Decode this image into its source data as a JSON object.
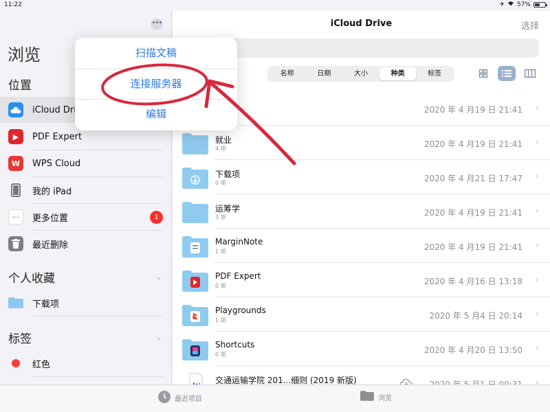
{
  "status_bar": {
    "time": "11:22",
    "battery": "57%",
    "battery_level": 0.57
  },
  "sidebar": {
    "more_label": "•••",
    "title": "浏览",
    "locations_header": "位置",
    "locations": [
      {
        "label": "iCloud Drive",
        "icon": "icloud-icon",
        "selected": true
      },
      {
        "label": "PDF Expert",
        "icon": "pdf-expert-icon"
      },
      {
        "label": "WPS Cloud",
        "icon": "wps-icon"
      },
      {
        "label": "我的 iPad",
        "icon": "ipad-icon"
      },
      {
        "label": "更多位置",
        "icon": "more-icon",
        "badge": "1"
      },
      {
        "label": "最近删除",
        "icon": "trash-icon"
      }
    ],
    "favorites_header": "个人收藏",
    "favorites": [
      {
        "label": "下载项",
        "icon": "folder-icon"
      }
    ],
    "tags_header": "标签",
    "tags": [
      {
        "label": "红色",
        "color": "#ff3b30"
      }
    ]
  },
  "popover": {
    "items": [
      "扫描文稿",
      "连接服务器",
      "编辑"
    ],
    "color": "#2f7ae5"
  },
  "main": {
    "title": "iCloud Drive",
    "select_label": "选择",
    "sort_tabs": [
      "名称",
      "日期",
      "大小",
      "种类",
      "标签"
    ],
    "active_sort": 3,
    "files": [
      {
        "name": "",
        "sub": "",
        "date": "2020 年 4 月19 日 21:41",
        "icon": "folder-icon"
      },
      {
        "name": "就业",
        "sub": "4 项",
        "date": "2020 年 4 月19 日 21:41",
        "icon": "folder-icon"
      },
      {
        "name": "下载项",
        "sub": "0 项",
        "date": "2020 年 4 月21 日 17:47",
        "icon": "download-folder-icon"
      },
      {
        "name": "运筹学",
        "sub": "3 项",
        "date": "2020 年 4 月19 日 21:41",
        "icon": "folder-icon"
      },
      {
        "name": "MarginNote",
        "sub": "1 项",
        "date": "2020 年 4 月19 日 21:41",
        "icon": "marginnote-folder-icon"
      },
      {
        "name": "PDF Expert",
        "sub": "0 项",
        "date": "2020 年 4 月16 日 13:18",
        "icon": "pdf-expert-folder-icon"
      },
      {
        "name": "Playgrounds",
        "sub": "1 项",
        "date": "2020 年 5 月4 日 20:14",
        "icon": "swift-folder-icon"
      },
      {
        "name": "Shortcuts",
        "sub": "0 项",
        "date": "2020 年 4 月20 日 13:50",
        "icon": "shortcuts-folder-icon"
      },
      {
        "name": "交通运输学院 201...细则 (2019 新版)",
        "sub": "",
        "date": "2020 年 5 月1 日 00:31",
        "icon": "word-doc-icon",
        "cloud": true
      }
    ]
  },
  "tab_bar": {
    "recent_label": "最近项目",
    "browse_label": "浏览"
  },
  "annotation": {
    "color": "#d8283c"
  }
}
